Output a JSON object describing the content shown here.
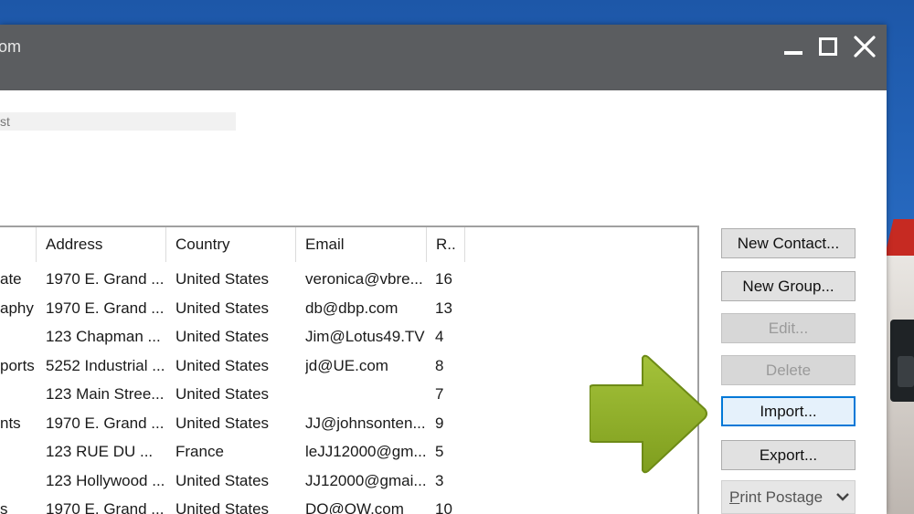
{
  "window": {
    "title": "om",
    "filter_value": "st"
  },
  "columns": [
    "",
    "Address",
    "Country",
    "Email",
    "R.."
  ],
  "rows": [
    {
      "name": "ate",
      "address": "1970 E. Grand ...",
      "country": "United States",
      "email": "veronica@vbre...",
      "r": "16"
    },
    {
      "name": "aphy",
      "address": "1970 E. Grand ...",
      "country": "United States",
      "email": "db@dbp.com",
      "r": "13"
    },
    {
      "name": "",
      "address": "123 Chapman ...",
      "country": "United States",
      "email": "Jim@Lotus49.TV",
      "r": "4"
    },
    {
      "name": "ports",
      "address": "5252 Industrial ...",
      "country": "United States",
      "email": "jd@UE.com",
      "r": "8"
    },
    {
      "name": "",
      "address": "123 Main Stree...",
      "country": "United States",
      "email": "",
      "r": "7"
    },
    {
      "name": "nts",
      "address": "1970 E. Grand ...",
      "country": "United States",
      "email": "JJ@johnsonten...",
      "r": "9"
    },
    {
      "name": "",
      "address": "123 RUE DU ...",
      "country": "France",
      "email": "leJJ12000@gm...",
      "r": "5"
    },
    {
      "name": "",
      "address": "123 Hollywood ...",
      "country": "United States",
      "email": "JJ12000@gmai...",
      "r": "3"
    },
    {
      "name": "s",
      "address": "1970 E. Grand ...",
      "country": "United States",
      "email": "DQ@QW.com",
      "r": "10"
    }
  ],
  "buttons": {
    "new_contact": "New Contact...",
    "new_group": "New Group...",
    "edit": "Edit...",
    "delete": "Delete",
    "import": "Import...",
    "export": "Export...",
    "print_postage_first": "P",
    "print_postage_rest": "rint Postage"
  },
  "colors": {
    "titlebar": "#5b5d60",
    "arrow": "#8fb02a",
    "focus": "#0078d7"
  }
}
